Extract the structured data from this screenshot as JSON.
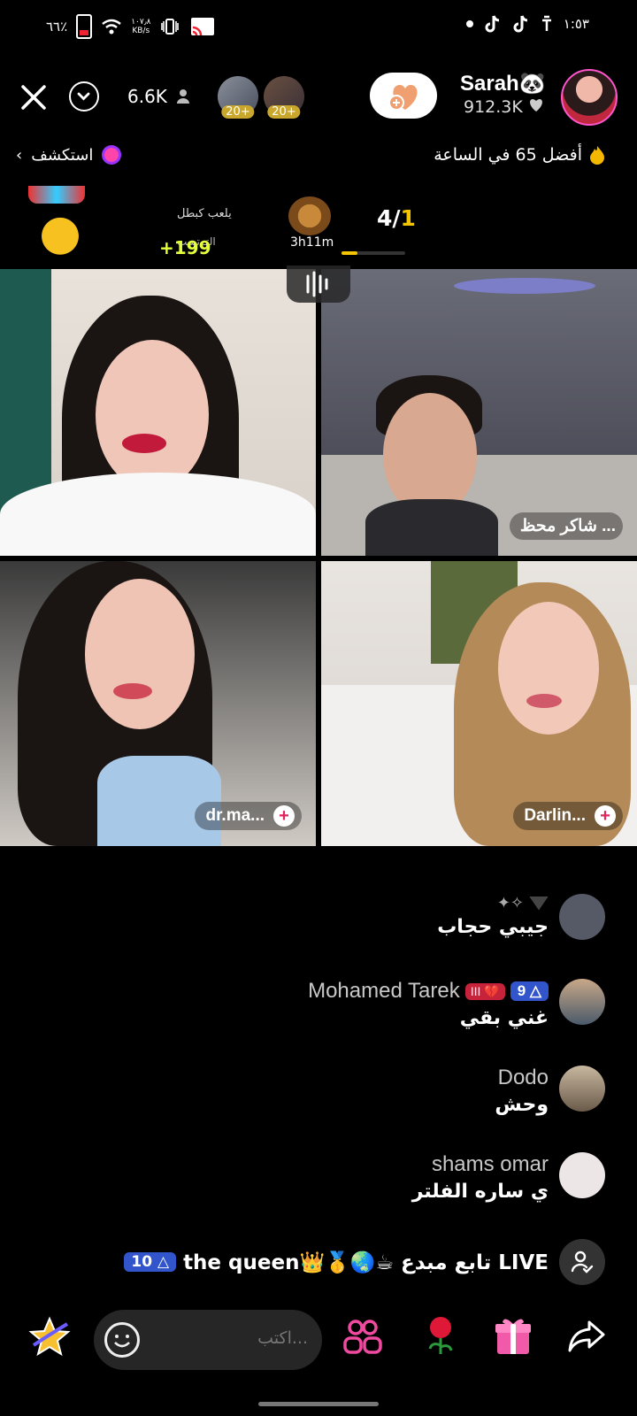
{
  "status_bar": {
    "battery": "٦٦٪",
    "speed_value": "١٠٧٫٨",
    "speed_unit": "KB/s",
    "time": "١:٥٣"
  },
  "header": {
    "viewer_count": "6.6K",
    "group_badges": [
      "20+",
      "20+"
    ],
    "host_name": "Sarah🐼",
    "host_likes": "912.3K"
  },
  "ranking": {
    "explore_label": "استكشف",
    "hourly_rank": "أفضل 65 في الساعة",
    "fire_icon": "fire-icon"
  },
  "game": {
    "line1": "يلعب كبطل",
    "line2": "التـ تسب",
    "score": "+199",
    "timer": "3h11m",
    "round_current": "1",
    "round_total": "4/",
    "round_progress": 0.25
  },
  "guests": [
    {
      "name": ""
    },
    {
      "name": "شاكر محظ ..."
    },
    {
      "name": "dr.ma..."
    },
    {
      "name": "Darlin..."
    }
  ],
  "chat": [
    {
      "user": "",
      "message": "جيبي حجاب",
      "avatar_color": "#555a66"
    },
    {
      "user": "Mohamed Tarek",
      "level": "9",
      "fan_badge": "III 💔",
      "message": "غني بقي",
      "avatar_color": "#7a6a5a"
    },
    {
      "user": "Dodo",
      "message": "وحش",
      "avatar_color": "#8a7a6a"
    },
    {
      "user": "shams omar",
      "message": "ي ساره الفلتر",
      "avatar_color": "#e8e0e0"
    },
    {
      "user": "",
      "level": "10",
      "message": "the queen👑🥇🌏☕ تابع مبدع LIVE",
      "avatar_color": "#333"
    }
  ],
  "bottom_bar": {
    "comment_placeholder": "اكتب..."
  }
}
